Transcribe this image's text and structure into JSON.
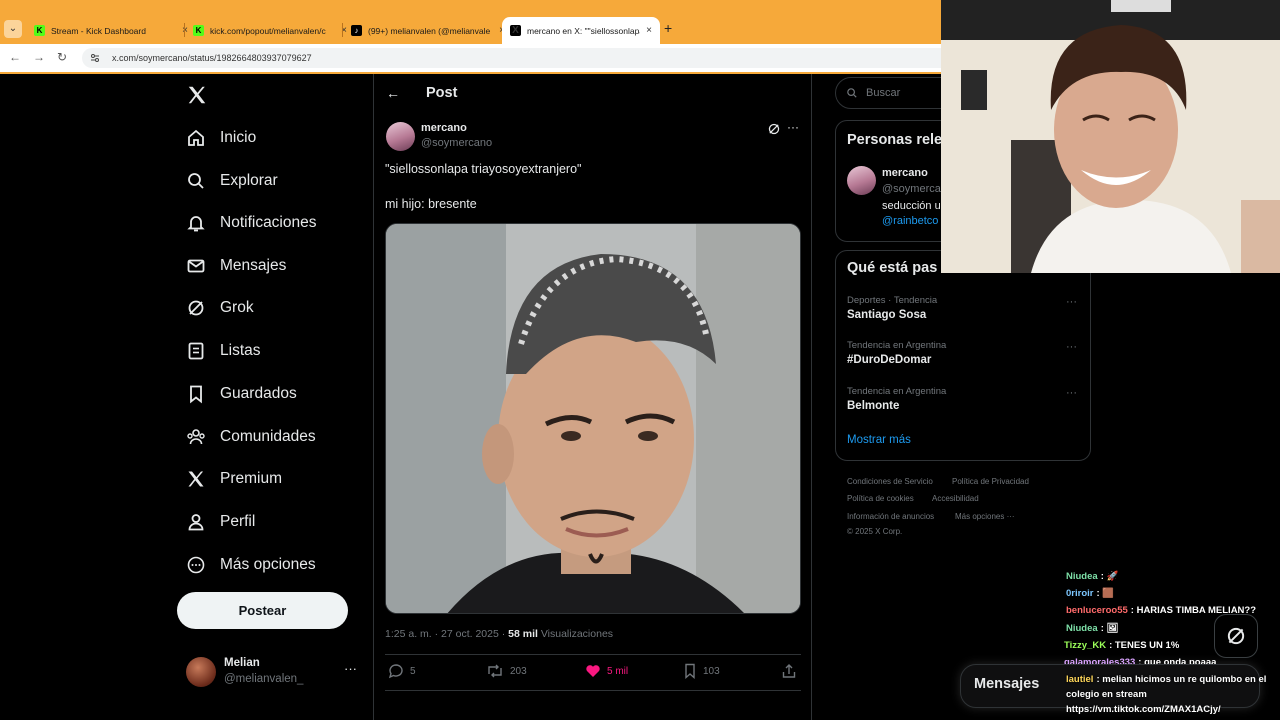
{
  "browser": {
    "tabs": [
      {
        "title": "Stream - Kick Dashboard",
        "icon": "kick-icon",
        "glyph": "K"
      },
      {
        "title": "kick.com/popout/melianvalen/c",
        "icon": "kick-icon",
        "glyph": "K"
      },
      {
        "title": "(99+) melianvalen (@melianvale",
        "icon": "tiktok-icon",
        "glyph": "♪"
      },
      {
        "title": "mercano en X: \"\"siellossonlapa",
        "icon": "x-icon",
        "glyph": "X"
      }
    ],
    "tab_close": "×",
    "new_tab": "+",
    "url": "x.com/soymercano/status/1982664803937079627",
    "accent": "#f6a93a"
  },
  "nav": {
    "items": [
      {
        "label": "Inicio",
        "icon": "home-icon"
      },
      {
        "label": "Explorar",
        "icon": "search-icon"
      },
      {
        "label": "Notificaciones",
        "icon": "bell-icon"
      },
      {
        "label": "Mensajes",
        "icon": "mail-icon"
      },
      {
        "label": "Grok",
        "icon": "grok-icon"
      },
      {
        "label": "Listas",
        "icon": "list-icon"
      },
      {
        "label": "Guardados",
        "icon": "bookmark-icon"
      },
      {
        "label": "Comunidades",
        "icon": "people-icon"
      },
      {
        "label": "Premium",
        "icon": "x-logo-icon"
      },
      {
        "label": "Perfil",
        "icon": "person-icon"
      },
      {
        "label": "Más opciones",
        "icon": "more-circle-icon"
      }
    ],
    "post_button": "Postear",
    "account": {
      "name": "Melian",
      "handle": "@melianvalen_",
      "more": "···"
    }
  },
  "post": {
    "header": "Post",
    "author_name": "mercano",
    "author_handle": "@soymercano",
    "more": "···",
    "text_line1": "\"siellossonlapa triayosoyextranjero\"",
    "text_line2": "mi hijo: bresente",
    "time": "1:25 a. m. · 27 oct. 2025 · ",
    "views_count": "58 mil",
    "views_label": " Visualizaciones",
    "replies": "5",
    "reposts": "203",
    "likes": "5 mil",
    "bookmarks": "103"
  },
  "sidebar": {
    "search_placeholder": "Buscar",
    "related_title": "Personas rele",
    "related": {
      "name": "mercano",
      "handle": "@soymerca",
      "bio": "seducción u",
      "link": "@rainbetco"
    },
    "trends_title": "Qué está pas",
    "trends": [
      {
        "category": "Deportes · Tendencia",
        "name": "Santiago Sosa"
      },
      {
        "category": "Tendencia en Argentina",
        "name": "#DuroDeDomar"
      },
      {
        "category": "Tendencia en Argentina",
        "name": "Belmonte"
      }
    ],
    "trend_more": "···",
    "show_more": "Mostrar más",
    "footer": [
      "Condiciones de Servicio",
      "Política de Privacidad",
      "Política de cookies",
      "Accesibilidad",
      "Información de anuncios",
      "Más opciones ···",
      "© 2025 X Corp."
    ]
  },
  "chat": [
    {
      "user": "Niudea",
      "color": "#7ee0a8",
      "msg": ": 🚀"
    },
    {
      "user": "0riroir",
      "color": "#7ec8ff",
      "msg": ": 🟫"
    },
    {
      "user": "benluceroo55",
      "color": "#ff6b6b",
      "msg": ": HARIAS TIMBA MELIAN??"
    },
    {
      "user": "Niudea",
      "color": "#7ee0a8",
      "msg": ": 🖼"
    },
    {
      "user": "Tizzy_KK",
      "color": "#9cff5a",
      "msg": ": TENES UN 1%"
    },
    {
      "user": "galamorales333",
      "color": "#d9a0ff",
      "msg": ": que onda poaaa"
    },
    {
      "user": "lautiel",
      "color": "#ffd75a",
      "msg": ": melian hicimos un re quilombo en el"
    },
    {
      "user": "",
      "color": "#ffffff",
      "msg": "colegio en stream"
    },
    {
      "user": "",
      "color": "#ffffff",
      "msg": "https://vm.tiktok.com/ZMAX1ACjy/"
    }
  ],
  "messages_dock": {
    "title": "Mensajes"
  }
}
